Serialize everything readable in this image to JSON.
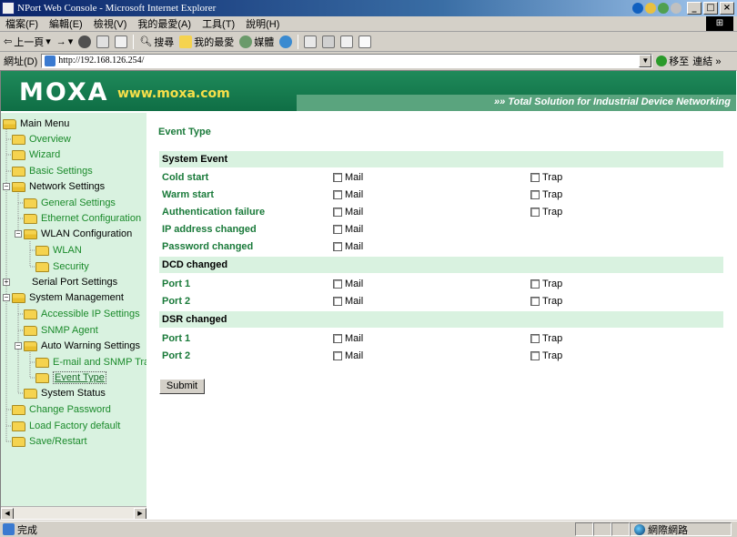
{
  "window": {
    "title": "NPort Web Console - Microsoft Internet Explorer",
    "buttons": [
      "_",
      "□",
      "×"
    ]
  },
  "menu": [
    "檔案(F)",
    "編輯(E)",
    "檢視(V)",
    "我的最愛(A)",
    "工具(T)",
    "說明(H)"
  ],
  "toolbar": {
    "back": "上一頁",
    "search": "搜尋",
    "favorites": "我的最愛",
    "media": "媒體"
  },
  "address": {
    "label": "網址(D)",
    "url": "http://192.168.126.254/",
    "go": "移至",
    "links": "連結 »"
  },
  "banner": {
    "logo": "MOXA",
    "site": "www.moxa.com",
    "tagline": "»» Total Solution for Industrial Device Networking"
  },
  "tree": [
    {
      "label": "Main Menu",
      "kind": "plain"
    },
    {
      "label": "Overview",
      "kind": "link"
    },
    {
      "label": "Wizard",
      "kind": "link"
    },
    {
      "label": "Basic Settings",
      "kind": "link"
    },
    {
      "label": "Network Settings",
      "kind": "plain"
    },
    {
      "label": "General Settings",
      "kind": "link"
    },
    {
      "label": "Ethernet Configuration",
      "kind": "link"
    },
    {
      "label": "WLAN Configuration",
      "kind": "plain"
    },
    {
      "label": "WLAN",
      "kind": "link"
    },
    {
      "label": "Security",
      "kind": "link"
    },
    {
      "label": "Serial Port Settings",
      "kind": "plain"
    },
    {
      "label": "System Management",
      "kind": "plain"
    },
    {
      "label": "Accessible IP Settings",
      "kind": "link"
    },
    {
      "label": "SNMP Agent",
      "kind": "link"
    },
    {
      "label": "Auto Warning Settings",
      "kind": "plain"
    },
    {
      "label": "E-mail and SNMP Trap",
      "kind": "link"
    },
    {
      "label": "Event Type",
      "kind": "current"
    },
    {
      "label": "System Status",
      "kind": "plain"
    },
    {
      "label": "Change Password",
      "kind": "link"
    },
    {
      "label": "Load Factory default",
      "kind": "link"
    },
    {
      "label": "Save/Restart",
      "kind": "link"
    }
  ],
  "content": {
    "heading": "Event Type",
    "mail_label": "Mail",
    "trap_label": "Trap",
    "submit": "Submit",
    "sections": [
      {
        "title": "System Event",
        "rows": [
          {
            "label": "Cold start",
            "mail": false,
            "trap": false,
            "has_trap": true
          },
          {
            "label": "Warm start",
            "mail": false,
            "trap": false,
            "has_trap": true
          },
          {
            "label": "Authentication failure",
            "mail": false,
            "trap": false,
            "has_trap": true
          },
          {
            "label": "IP address changed",
            "mail": false,
            "has_trap": false
          },
          {
            "label": "Password changed",
            "mail": false,
            "has_trap": false
          }
        ]
      },
      {
        "title": "DCD changed",
        "rows": [
          {
            "label": "Port 1",
            "mail": false,
            "trap": false,
            "has_trap": true
          },
          {
            "label": "Port 2",
            "mail": false,
            "trap": false,
            "has_trap": true
          }
        ]
      },
      {
        "title": "DSR changed",
        "rows": [
          {
            "label": "Port 1",
            "mail": false,
            "trap": false,
            "has_trap": true
          },
          {
            "label": "Port 2",
            "mail": false,
            "trap": false,
            "has_trap": true
          }
        ]
      }
    ]
  },
  "status": {
    "text": "完成",
    "zone": "網際網路"
  }
}
